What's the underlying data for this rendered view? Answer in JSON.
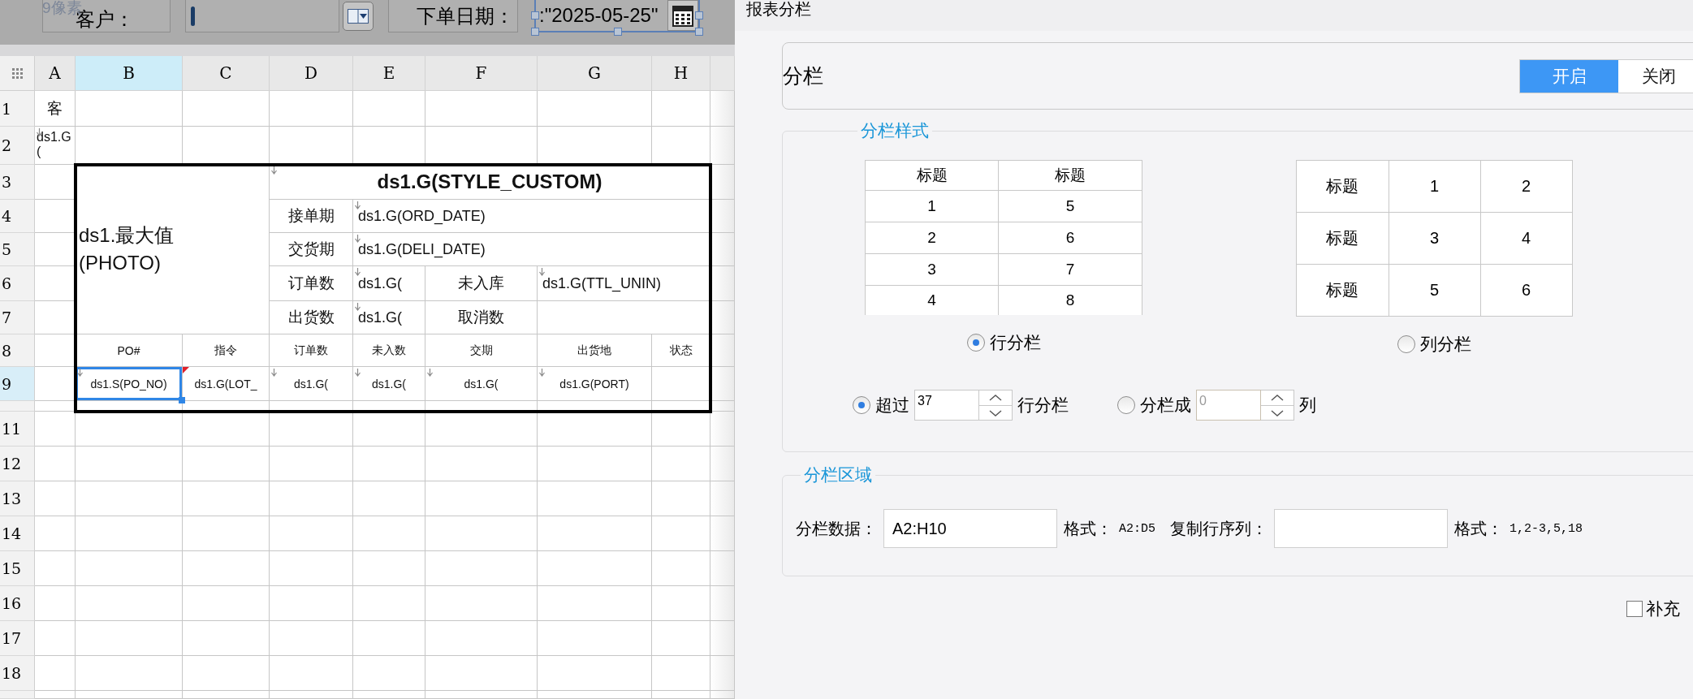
{
  "toolbar": {
    "overlay_label": "9像素",
    "customer_label": "客户：",
    "date_label": "下单日期：",
    "date_field": {
      "value": ":\"2025-05-25\"",
      "selected": true
    }
  },
  "sheet": {
    "columns": [
      {
        "label": "A",
        "selected": false
      },
      {
        "label": "B",
        "selected": true
      },
      {
        "label": "C",
        "selected": false
      },
      {
        "label": "D",
        "selected": false
      },
      {
        "label": "E",
        "selected": false
      },
      {
        "label": "F",
        "selected": false
      },
      {
        "label": "G",
        "selected": false
      },
      {
        "label": "H",
        "selected": false
      }
    ],
    "rows": [
      {
        "label": "1",
        "selected": false
      },
      {
        "label": "2",
        "selected": false
      },
      {
        "label": "3",
        "selected": false
      },
      {
        "label": "4",
        "selected": false
      },
      {
        "label": "5",
        "selected": false
      },
      {
        "label": "6",
        "selected": false
      },
      {
        "label": "7",
        "selected": false
      },
      {
        "label": "8",
        "selected": false
      },
      {
        "label": "9",
        "selected": true
      },
      {
        "label": "11",
        "selected": false
      },
      {
        "label": "12",
        "selected": false
      },
      {
        "label": "13",
        "selected": false
      },
      {
        "label": "14",
        "selected": false
      },
      {
        "label": "15",
        "selected": false
      },
      {
        "label": "16",
        "selected": false
      },
      {
        "label": "17",
        "selected": false
      },
      {
        "label": "18",
        "selected": false
      }
    ],
    "cells": [
      {
        "text": "客",
        "kind": "caption",
        "expand": false,
        "flagged": false,
        "selected": false
      },
      {
        "text": "ds1.G(",
        "kind": "narrow",
        "expand": true,
        "flagged": false,
        "selected": false
      },
      {
        "text": "ds1.最大值(PHOTO)",
        "kind": "large",
        "expand": false,
        "flagged": false,
        "selected": false
      },
      {
        "text": "ds1.G(STYLE_CUSTOM)",
        "kind": "title",
        "expand": true,
        "flagged": false,
        "selected": false
      },
      {
        "text": "接单期",
        "kind": "caption",
        "expand": false,
        "flagged": false,
        "selected": false
      },
      {
        "text": "ds1.G(ORD_DATE)",
        "kind": "field",
        "expand": true,
        "flagged": false,
        "selected": false
      },
      {
        "text": "交货期",
        "kind": "caption",
        "expand": false,
        "flagged": false,
        "selected": false
      },
      {
        "text": "ds1.G(DELI_DATE)",
        "kind": "field",
        "expand": true,
        "flagged": false,
        "selected": false
      },
      {
        "text": "订单数",
        "kind": "caption",
        "expand": false,
        "flagged": false,
        "selected": false
      },
      {
        "text": "ds1.G(",
        "kind": "field",
        "expand": true,
        "flagged": false,
        "selected": false
      },
      {
        "text": "未入库",
        "kind": "caption",
        "expand": false,
        "flagged": false,
        "selected": false
      },
      {
        "text": "ds1.G(TTL_UNIN)",
        "kind": "field",
        "expand": true,
        "flagged": false,
        "selected": false
      },
      {
        "text": "出货数",
        "kind": "caption",
        "expand": false,
        "flagged": false,
        "selected": false
      },
      {
        "text": "ds1.G(",
        "kind": "field",
        "expand": true,
        "flagged": false,
        "selected": false
      },
      {
        "text": "取消数",
        "kind": "caption",
        "expand": false,
        "flagged": false,
        "selected": false
      },
      {
        "text": "PO#",
        "kind": "small",
        "expand": false,
        "flagged": false,
        "selected": false
      },
      {
        "text": "指令",
        "kind": "small",
        "expand": false,
        "flagged": false,
        "selected": false
      },
      {
        "text": "订单数",
        "kind": "small",
        "expand": false,
        "flagged": false,
        "selected": false
      },
      {
        "text": "未入数",
        "kind": "small",
        "expand": false,
        "flagged": false,
        "selected": false
      },
      {
        "text": "交期",
        "kind": "small",
        "expand": false,
        "flagged": false,
        "selected": false
      },
      {
        "text": "出货地",
        "kind": "small",
        "expand": false,
        "flagged": false,
        "selected": false
      },
      {
        "text": "状态",
        "kind": "small",
        "expand": false,
        "flagged": false,
        "selected": false
      },
      {
        "text": "ds1.S(PO_NO)",
        "kind": "small",
        "expand": true,
        "flagged": false,
        "selected": true
      },
      {
        "text": "ds1.G(LOT_",
        "kind": "small",
        "expand": false,
        "flagged": true,
        "selected": false
      },
      {
        "text": "ds1.G(",
        "kind": "small",
        "expand": true,
        "flagged": false,
        "selected": false
      },
      {
        "text": "ds1.G(",
        "kind": "small",
        "expand": true,
        "flagged": false,
        "selected": false
      },
      {
        "text": "ds1.G(",
        "kind": "small",
        "expand": true,
        "flagged": false,
        "selected": false
      },
      {
        "text": "ds1.G(PORT)",
        "kind": "small",
        "expand": true,
        "flagged": false,
        "selected": false
      }
    ]
  },
  "dialog": {
    "title": "报表分栏",
    "columns_panel": {
      "label": "分栏",
      "toggle": [
        {
          "label": "开启",
          "selected": true
        },
        {
          "label": "关闭",
          "selected": false
        }
      ]
    },
    "style_group": {
      "legend": "分栏样式",
      "row_preview": {
        "header": [
          "标题",
          "标题"
        ],
        "rows": [
          [
            "1",
            "5"
          ],
          [
            "2",
            "6"
          ],
          [
            "3",
            "7"
          ],
          [
            "4",
            "8"
          ]
        ]
      },
      "column_preview": {
        "rows": [
          [
            "标题",
            "1",
            "2"
          ],
          [
            "标题",
            "3",
            "4"
          ],
          [
            "标题",
            "5",
            "6"
          ]
        ]
      },
      "layouts": [
        {
          "label": "行分栏",
          "selected": true
        },
        {
          "label": "列分栏",
          "selected": false
        }
      ],
      "limits": [
        {
          "label": "超过",
          "value": "37",
          "unit": "行分栏",
          "selected": true,
          "disabled": false
        },
        {
          "label": "分栏成",
          "value": "0",
          "unit": "列",
          "selected": false,
          "disabled": true
        }
      ]
    },
    "area_group": {
      "legend": "分栏区域",
      "data_label": "分栏数据：",
      "data_value": "A2:H10",
      "data_hint_label": "格式：",
      "data_hint": "A2:D5",
      "copy_label": "复制行序列：",
      "copy_hint_label": "格式：",
      "copy_hint": "1,2-3,5,18"
    },
    "fill": {
      "label": "补充",
      "checked": false
    }
  }
}
